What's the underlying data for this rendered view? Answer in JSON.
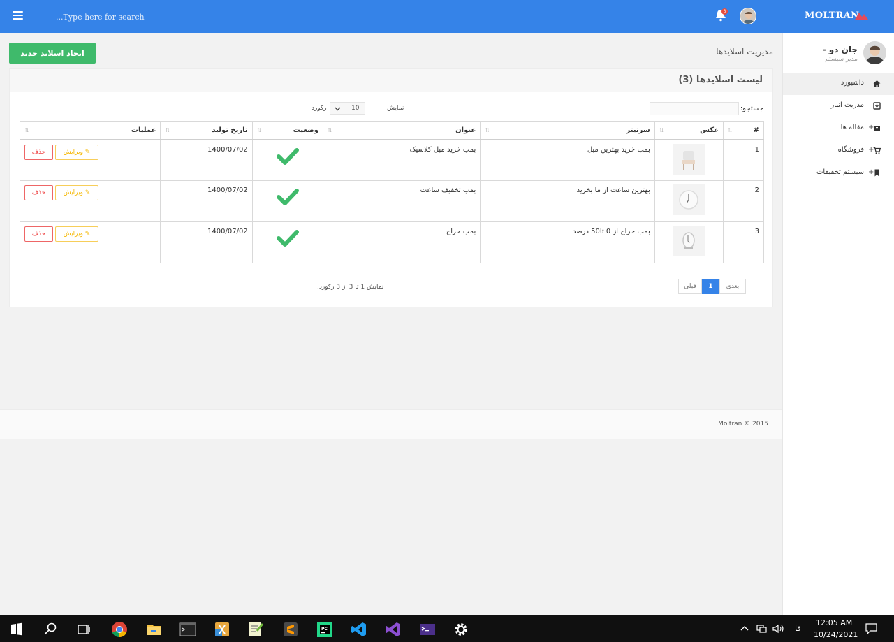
{
  "topbar": {
    "search_placeholder": "...Type here for search",
    "notification_count": "3",
    "brand": "MOLTRAN"
  },
  "sidebar": {
    "user_name": "جان دو -",
    "user_role": "مدیر سیستم",
    "items": [
      {
        "label": "داشبورد",
        "icon": "home-icon",
        "plus": ""
      },
      {
        "label": "مدریت انبار",
        "icon": "inbox-icon",
        "plus": ""
      },
      {
        "label": "مقاله ها",
        "icon": "archive-icon",
        "plus": "+"
      },
      {
        "label": "فروشگاه",
        "icon": "cart-icon",
        "plus": "+"
      },
      {
        "label": "سیستم تخفیفات",
        "icon": "bookmark-icon",
        "plus": "+"
      }
    ]
  },
  "page": {
    "title": "مدیریت اسلایدها",
    "create_button": "ایجاد اسلاید جدید"
  },
  "panel": {
    "title": "لیست اسلایدها (3)",
    "search_label": "جستجو:",
    "length_show": "نمایش",
    "length_value": "10",
    "length_records": "رکورد",
    "columns": [
      "#",
      "عکس",
      "سرتیتر",
      "عنوان",
      "وضعیت",
      "تاریخ تولید",
      "عملیات"
    ],
    "rows": [
      {
        "num": "1",
        "headline": "بمب خرید بهترین مبل",
        "title": "بمب خرید مبل کلاسیک",
        "date": "1400/07/02"
      },
      {
        "num": "2",
        "headline": "بهترین ساعت از ما بخرید",
        "title": "بمب تخفیف ساعت",
        "date": "1400/07/02"
      },
      {
        "num": "3",
        "headline": "بمب حراج از 0 تا50 درصد",
        "title": "بمب حراج",
        "date": "1400/07/02"
      }
    ],
    "edit_label": "ویرایش",
    "delete_label": "حذف",
    "info": "نمایش 1 تا 3 از 3 رکورد.",
    "pager": {
      "prev": "قبلی",
      "current": "1",
      "next": "بعدی"
    }
  },
  "footer": {
    "text": "Moltran © 2015."
  },
  "taskbar": {
    "apps": [
      "windows-start-icon",
      "search-icon",
      "task-view-icon",
      "chrome-icon",
      "file-explorer-icon",
      "terminal-icon",
      "xampp-icon",
      "notepad-plus-icon",
      "sublime-icon",
      "pycharm-icon",
      "vscode-icon",
      "visual-studio-icon",
      "powershell-icon",
      "settings-icon"
    ],
    "lang": "فا",
    "time": "12:05 AM",
    "date": "10/24/2021"
  },
  "colors": {
    "primary": "#3583e8",
    "success": "#3fba6b",
    "warning": "#f5b700",
    "danger": "#e44444"
  }
}
